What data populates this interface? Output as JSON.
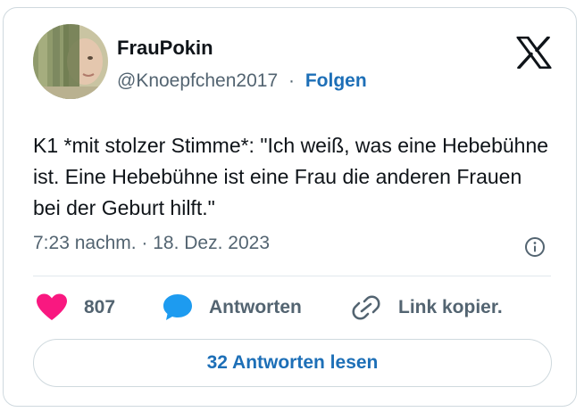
{
  "author": {
    "display_name": "FrauPokin",
    "handle": "@Knoepfchen2017",
    "separator": "·",
    "follow_label": "Folgen"
  },
  "tweet": {
    "text": "K1 *mit stolzer Stimme*: \"Ich weiß, was eine Hebebühne ist. Eine Hebebühne ist eine Frau die anderen Frauen bei der Geburt hilft.\"",
    "timestamp": "7:23 nachm. · 18. Dez. 2023"
  },
  "actions": {
    "like_count": "807",
    "reply_label": "Antworten",
    "copy_link_label": "Link kopier."
  },
  "read_replies_label": "32 Antworten lesen",
  "colors": {
    "heart": "#f91880",
    "reply_bubble": "#1d9bf0",
    "link_blue": "#1d6fb7",
    "secondary_text": "#536471",
    "border": "#cfd9de"
  },
  "icons": {
    "brand": "x-logo-icon",
    "info": "info-icon",
    "like": "heart-icon",
    "reply": "speech-bubble-icon",
    "copy": "link-icon"
  }
}
